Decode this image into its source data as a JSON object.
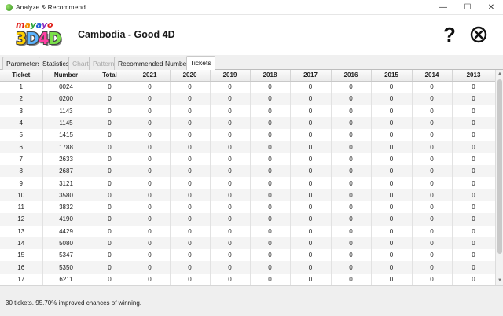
{
  "window": {
    "title": "Analyze & Recommend",
    "minimize_glyph": "—",
    "maximize_glyph": "☐",
    "close_glyph": "✕"
  },
  "logo": {
    "top_letters": [
      "m",
      "a",
      "y",
      "a",
      "y",
      "o"
    ],
    "top_colors": [
      "#e0201b",
      "#f28c00",
      "#2aa33a",
      "#1f5fd6",
      "#8f2fc4",
      "#e0201b"
    ],
    "bottom_letters": [
      "3",
      "D",
      "4",
      "D"
    ],
    "bottom_colors": [
      "#ffd000",
      "#5ab4ff",
      "#ff3fa4",
      "#7be04a"
    ]
  },
  "header": {
    "title": "Cambodia - Good 4D",
    "help_glyph": "?",
    "close_icon": "circle-x-icon"
  },
  "tabs": [
    {
      "label": "Parameters",
      "state": "normal"
    },
    {
      "label": "Statistics",
      "state": "normal"
    },
    {
      "label": "Chart",
      "state": "disabled"
    },
    {
      "label": "Pattern",
      "state": "disabled"
    },
    {
      "label": "Recommended Numbers",
      "state": "normal"
    },
    {
      "label": "Tickets",
      "state": "active"
    }
  ],
  "table": {
    "columns": [
      "Ticket",
      "Number",
      "Total",
      "2021",
      "2020",
      "2019",
      "2018",
      "2017",
      "2016",
      "2015",
      "2014",
      "2013"
    ],
    "rows": [
      [
        "1",
        "0024",
        "0",
        "0",
        "0",
        "0",
        "0",
        "0",
        "0",
        "0",
        "0",
        "0"
      ],
      [
        "2",
        "0200",
        "0",
        "0",
        "0",
        "0",
        "0",
        "0",
        "0",
        "0",
        "0",
        "0"
      ],
      [
        "3",
        "1143",
        "0",
        "0",
        "0",
        "0",
        "0",
        "0",
        "0",
        "0",
        "0",
        "0"
      ],
      [
        "4",
        "1145",
        "0",
        "0",
        "0",
        "0",
        "0",
        "0",
        "0",
        "0",
        "0",
        "0"
      ],
      [
        "5",
        "1415",
        "0",
        "0",
        "0",
        "0",
        "0",
        "0",
        "0",
        "0",
        "0",
        "0"
      ],
      [
        "6",
        "1788",
        "0",
        "0",
        "0",
        "0",
        "0",
        "0",
        "0",
        "0",
        "0",
        "0"
      ],
      [
        "7",
        "2633",
        "0",
        "0",
        "0",
        "0",
        "0",
        "0",
        "0",
        "0",
        "0",
        "0"
      ],
      [
        "8",
        "2687",
        "0",
        "0",
        "0",
        "0",
        "0",
        "0",
        "0",
        "0",
        "0",
        "0"
      ],
      [
        "9",
        "3121",
        "0",
        "0",
        "0",
        "0",
        "0",
        "0",
        "0",
        "0",
        "0",
        "0"
      ],
      [
        "10",
        "3580",
        "0",
        "0",
        "0",
        "0",
        "0",
        "0",
        "0",
        "0",
        "0",
        "0"
      ],
      [
        "11",
        "3832",
        "0",
        "0",
        "0",
        "0",
        "0",
        "0",
        "0",
        "0",
        "0",
        "0"
      ],
      [
        "12",
        "4190",
        "0",
        "0",
        "0",
        "0",
        "0",
        "0",
        "0",
        "0",
        "0",
        "0"
      ],
      [
        "13",
        "4429",
        "0",
        "0",
        "0",
        "0",
        "0",
        "0",
        "0",
        "0",
        "0",
        "0"
      ],
      [
        "14",
        "5080",
        "0",
        "0",
        "0",
        "0",
        "0",
        "0",
        "0",
        "0",
        "0",
        "0"
      ],
      [
        "15",
        "5347",
        "0",
        "0",
        "0",
        "0",
        "0",
        "0",
        "0",
        "0",
        "0",
        "0"
      ],
      [
        "16",
        "5350",
        "0",
        "0",
        "0",
        "0",
        "0",
        "0",
        "0",
        "0",
        "0",
        "0"
      ],
      [
        "17",
        "6211",
        "0",
        "0",
        "0",
        "0",
        "0",
        "0",
        "0",
        "0",
        "0",
        "0"
      ]
    ]
  },
  "status": {
    "text": "30 tickets. 95.70% improved chances of winning."
  }
}
